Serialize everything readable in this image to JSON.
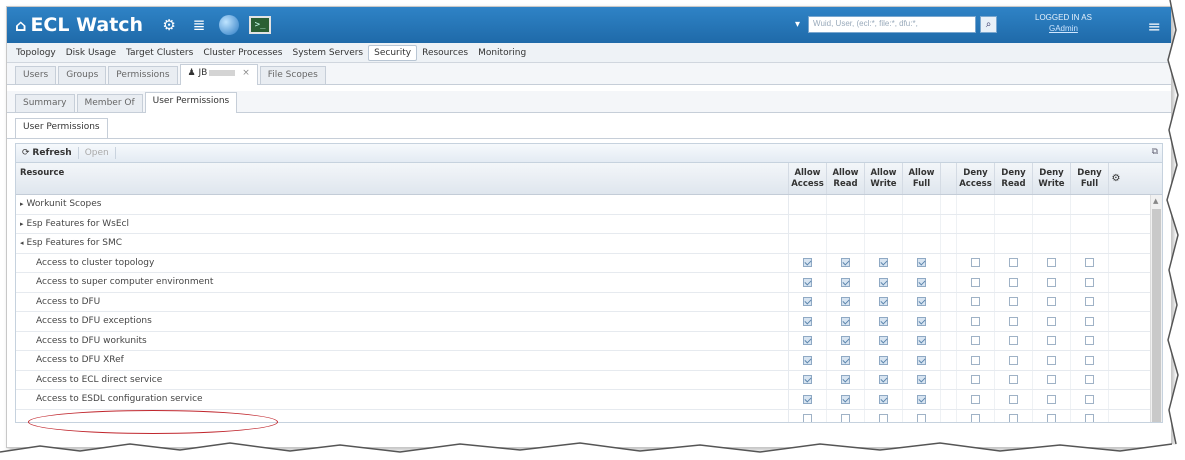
{
  "app": {
    "title": "ECL Watch",
    "search_placeholder": "Wuid, User, (ecl:*, file:*, dfu:*,",
    "logged_in_label": "LOGGED IN AS",
    "logged_in_user": "GAdmin"
  },
  "main_nav": [
    "Topology",
    "Disk Usage",
    "Target Clusters",
    "Cluster Processes",
    "System Servers",
    "Security",
    "Resources",
    "Monitoring"
  ],
  "main_nav_active": "Security",
  "security_tabs": {
    "users": "Users",
    "groups": "Groups",
    "permissions": "Permissions",
    "user_tab": "JB",
    "file_scopes": "File Scopes"
  },
  "user_tabs": {
    "summary": "Summary",
    "member_of": "Member Of",
    "user_permissions": "User Permissions"
  },
  "panel_title": "User Permissions",
  "toolbar": {
    "refresh": "Refresh",
    "open": "Open"
  },
  "grid": {
    "resource_header": "Resource",
    "columns": [
      [
        "Allow",
        "Access"
      ],
      [
        "Allow",
        "Read"
      ],
      [
        "Allow",
        "Write"
      ],
      [
        "Allow",
        "Full"
      ],
      [
        "Deny",
        "Access"
      ],
      [
        "Deny",
        "Read"
      ],
      [
        "Deny",
        "Write"
      ],
      [
        "Deny",
        "Full"
      ]
    ],
    "rows": [
      {
        "label": "Workunit Scopes",
        "kind": "group",
        "expander": "▸",
        "checks": null
      },
      {
        "label": "Esp Features for WsEcl",
        "kind": "group",
        "expander": "▸",
        "checks": null
      },
      {
        "label": "Esp Features for SMC",
        "kind": "group",
        "expander": "◂",
        "checks": null
      },
      {
        "label": "Access to cluster topology",
        "kind": "child",
        "checks": [
          1,
          1,
          1,
          1,
          0,
          0,
          0,
          0
        ]
      },
      {
        "label": "Access to super computer environment",
        "kind": "child",
        "checks": [
          1,
          1,
          1,
          1,
          0,
          0,
          0,
          0
        ]
      },
      {
        "label": "Access to DFU",
        "kind": "child",
        "checks": [
          1,
          1,
          1,
          1,
          0,
          0,
          0,
          0
        ]
      },
      {
        "label": "Access to DFU exceptions",
        "kind": "child",
        "checks": [
          1,
          1,
          1,
          1,
          0,
          0,
          0,
          0
        ]
      },
      {
        "label": "Access to DFU workunits",
        "kind": "child",
        "checks": [
          1,
          1,
          1,
          1,
          0,
          0,
          0,
          0
        ]
      },
      {
        "label": "Access to DFU XRef",
        "kind": "child",
        "checks": [
          1,
          1,
          1,
          1,
          0,
          0,
          0,
          0
        ]
      },
      {
        "label": "Access to ECL direct service",
        "kind": "child",
        "checks": [
          1,
          1,
          1,
          1,
          0,
          0,
          0,
          0
        ]
      },
      {
        "label": "Access to ESDL configuration service",
        "kind": "child",
        "checks": [
          1,
          1,
          1,
          1,
          0,
          0,
          0,
          0
        ]
      },
      {
        "label": "",
        "kind": "child",
        "checks": [
          0,
          0,
          0,
          0,
          0,
          0,
          0,
          0
        ]
      }
    ]
  },
  "colors": {
    "header_blue": "#1f6aa9",
    "annotation_red": "#c0262d"
  }
}
